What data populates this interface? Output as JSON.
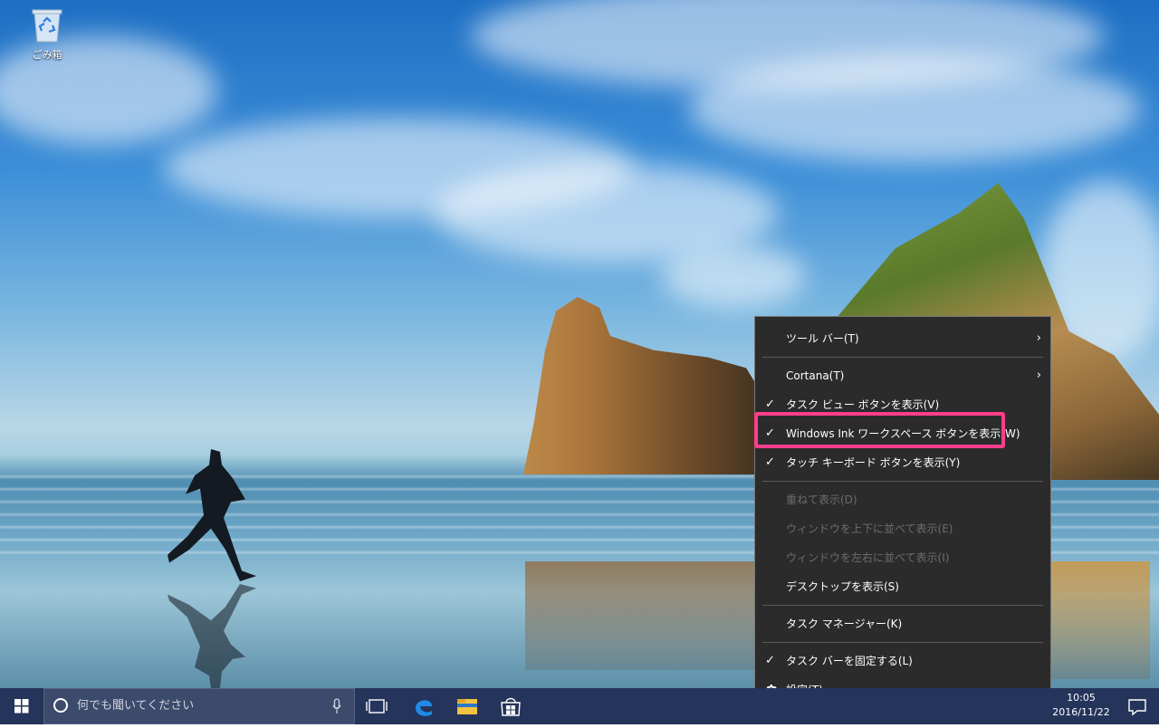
{
  "desktop": {
    "recycle_bin_label": "ごみ箱"
  },
  "context_menu": {
    "items": [
      {
        "label": "ツール バー(T)",
        "checked": false,
        "submenu": true,
        "disabled": false
      },
      {
        "label": "Cortana(T)",
        "checked": false,
        "submenu": true,
        "disabled": false
      },
      {
        "label": "タスク ビュー ボタンを表示(V)",
        "checked": true,
        "submenu": false,
        "disabled": false
      },
      {
        "label": "Windows Ink ワークスペース ボタンを表示(W)",
        "checked": true,
        "submenu": false,
        "disabled": false
      },
      {
        "label": "タッチ キーボード ボタンを表示(Y)",
        "checked": true,
        "submenu": false,
        "disabled": false
      },
      {
        "label": "重ねて表示(D)",
        "checked": false,
        "submenu": false,
        "disabled": true
      },
      {
        "label": "ウィンドウを上下に並べて表示(E)",
        "checked": false,
        "submenu": false,
        "disabled": true
      },
      {
        "label": "ウィンドウを左右に並べて表示(I)",
        "checked": false,
        "submenu": false,
        "disabled": true
      },
      {
        "label": "デスクトップを表示(S)",
        "checked": false,
        "submenu": false,
        "disabled": false
      },
      {
        "label": "タスク マネージャー(K)",
        "checked": false,
        "submenu": false,
        "disabled": false
      },
      {
        "label": "タスク バーを固定する(L)",
        "checked": true,
        "submenu": false,
        "disabled": false
      },
      {
        "label": "設定(T)",
        "checked": false,
        "submenu": false,
        "disabled": false,
        "icon": "gear-icon"
      }
    ],
    "check_glyph": "✓",
    "arrow_glyph": "›",
    "highlight_color": "#ff3e8b"
  },
  "taskbar": {
    "search_placeholder": "何でも聞いてください",
    "clock_time": "10:05",
    "clock_date": "2016/11/22",
    "background_color": "#25345a"
  }
}
